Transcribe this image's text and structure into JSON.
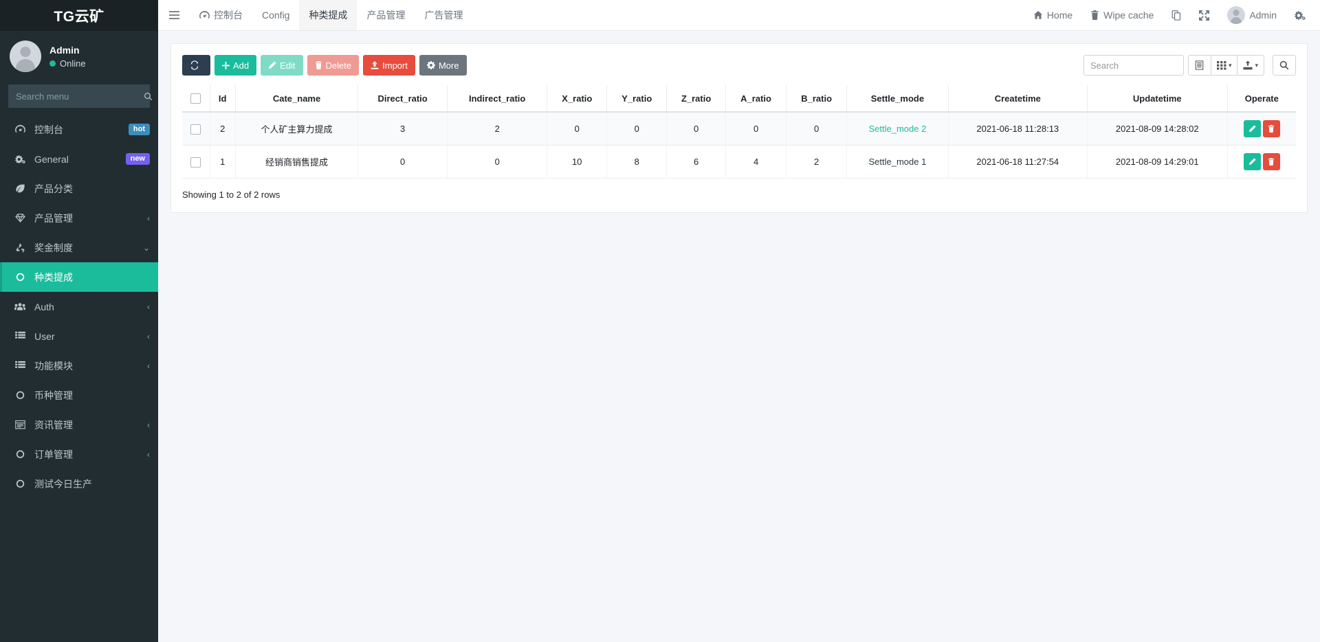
{
  "brand": {
    "title": "TG云矿"
  },
  "user_panel": {
    "name": "Admin",
    "status": "Online",
    "avatar_icon": "user-avatar-icon"
  },
  "sidebar_search": {
    "placeholder": "Search menu",
    "value": "",
    "icon": "search-icon"
  },
  "sidebar": {
    "items": [
      {
        "label": "控制台",
        "icon": "dashboard-icon",
        "badge": "hot",
        "badge_type": "hot",
        "chevron": "",
        "active": false
      },
      {
        "label": "General",
        "icon": "gears-icon",
        "badge": "new",
        "badge_type": "new",
        "chevron": "",
        "active": false
      },
      {
        "label": "产品分类",
        "icon": "leaf-icon",
        "badge": "",
        "badge_type": "",
        "chevron": "",
        "active": false
      },
      {
        "label": "产品管理",
        "icon": "diamond-icon",
        "badge": "",
        "badge_type": "",
        "chevron": "‹",
        "active": false
      },
      {
        "label": "奖金制度",
        "icon": "recycle-icon",
        "badge": "",
        "badge_type": "",
        "chevron": "⌄",
        "active": false
      },
      {
        "label": "种类提成",
        "icon": "circle-o-icon",
        "badge": "",
        "badge_type": "",
        "chevron": "",
        "active": true
      },
      {
        "label": "Auth",
        "icon": "users-icon",
        "badge": "",
        "badge_type": "",
        "chevron": "‹",
        "active": false
      },
      {
        "label": "User",
        "icon": "list-icon",
        "badge": "",
        "badge_type": "",
        "chevron": "‹",
        "active": false
      },
      {
        "label": "功能模块",
        "icon": "list-icon",
        "badge": "",
        "badge_type": "",
        "chevron": "‹",
        "active": false
      },
      {
        "label": "币种管理",
        "icon": "circle-o-icon",
        "badge": "",
        "badge_type": "",
        "chevron": "",
        "active": false
      },
      {
        "label": "资讯管理",
        "icon": "window-icon",
        "badge": "",
        "badge_type": "",
        "chevron": "‹",
        "active": false
      },
      {
        "label": "订单管理",
        "icon": "circle-o-icon",
        "badge": "",
        "badge_type": "",
        "chevron": "‹",
        "active": false
      },
      {
        "label": "测试今日生产",
        "icon": "circle-o-icon",
        "badge": "",
        "badge_type": "",
        "chevron": "",
        "active": false
      }
    ]
  },
  "topbar": {
    "hamburger_icon": "hamburger-icon",
    "tabs": [
      {
        "label": "控制台",
        "icon": "dashboard-icon",
        "active": false
      },
      {
        "label": "Config",
        "icon": "",
        "active": false
      },
      {
        "label": "种类提成",
        "icon": "",
        "active": true
      },
      {
        "label": "产品管理",
        "icon": "",
        "active": false
      },
      {
        "label": "广告管理",
        "icon": "",
        "active": false
      }
    ],
    "right_items": [
      {
        "label": "Home",
        "icon": "home-icon"
      },
      {
        "label": "Wipe cache",
        "icon": "trash-icon"
      },
      {
        "label": "",
        "icon": "copy-icon"
      },
      {
        "label": "",
        "icon": "fullscreen-icon"
      },
      {
        "label": "Admin",
        "icon": "user-avatar-icon"
      },
      {
        "label": "",
        "icon": "gears-icon"
      }
    ]
  },
  "toolbar": {
    "refresh_label": "",
    "refresh_icon": "refresh-icon",
    "add_label": "Add",
    "edit_label": "Edit",
    "delete_label": "Delete",
    "import_label": "Import",
    "more_label": "More",
    "search_placeholder": "Search",
    "search_value": "",
    "columns_icon": "columns-icon",
    "grid_icon": "grid-icon",
    "export_icon": "export-icon",
    "search_icon": "search-icon"
  },
  "table": {
    "columns": [
      "",
      "Id",
      "Cate_name",
      "Direct_ratio",
      "Indirect_ratio",
      "X_ratio",
      "Y_ratio",
      "Z_ratio",
      "A_ratio",
      "B_ratio",
      "Settle_mode",
      "Createtime",
      "Updatetime",
      "Operate"
    ],
    "rows": [
      {
        "id": "2",
        "cate_name": "个人矿主算力提成",
        "direct_ratio": "3",
        "indirect_ratio": "2",
        "x_ratio": "0",
        "y_ratio": "0",
        "z_ratio": "0",
        "a_ratio": "0",
        "b_ratio": "0",
        "settle_mode": "Settle_mode 2",
        "settle_mode_color": "#1abc9c",
        "createtime": "2021-06-18 11:28:13",
        "updatetime": "2021-08-09 14:28:02"
      },
      {
        "id": "1",
        "cate_name": "经销商销售提成",
        "direct_ratio": "0",
        "indirect_ratio": "0",
        "x_ratio": "10",
        "y_ratio": "8",
        "z_ratio": "6",
        "a_ratio": "4",
        "b_ratio": "2",
        "settle_mode": "Settle_mode 1",
        "settle_mode_color": "#2f3a40",
        "createtime": "2021-06-18 11:27:54",
        "updatetime": "2021-08-09 14:29:01"
      }
    ],
    "row_edit_icon": "pencil-icon",
    "row_delete_icon": "trash-icon",
    "showing_text": "Showing 1 to 2 of 2 rows"
  },
  "colors": {
    "sidebar_bg": "#222d32",
    "brand_bg": "#1a2226",
    "accent_teal": "#1abc9c",
    "danger_red": "#e74c3c",
    "badge_hot": "#3c8dbc",
    "badge_new": "#7460ee",
    "page_bg": "#f4f6f9"
  }
}
